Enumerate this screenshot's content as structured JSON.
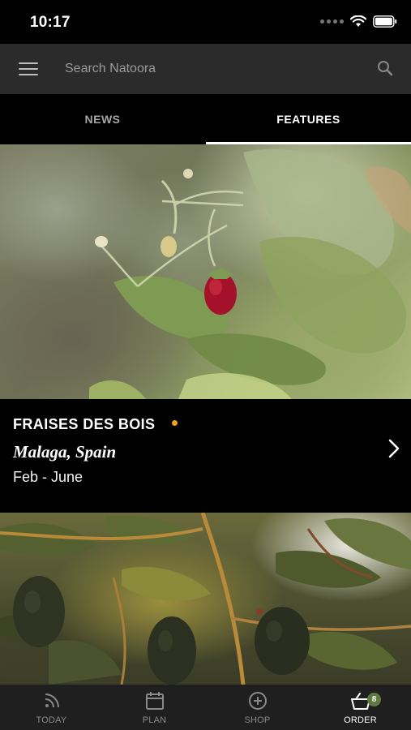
{
  "status_bar": {
    "time": "10:17"
  },
  "search": {
    "placeholder": "Search Natoora"
  },
  "tabs": [
    {
      "label": "NEWS",
      "active": false
    },
    {
      "label": "FEATURES",
      "active": true
    }
  ],
  "feature": {
    "title": "FRAISES DES BOIS",
    "origin": "Malaga, Spain",
    "season": "Feb - June",
    "season_dot_color": "#f0a21c"
  },
  "bottom_nav": {
    "items": [
      {
        "label": "TODAY",
        "icon": "signal-icon",
        "active": false
      },
      {
        "label": "PLAN",
        "icon": "calendar-icon",
        "active": false
      },
      {
        "label": "SHOP",
        "icon": "plus-circle-icon",
        "active": false
      },
      {
        "label": "ORDER",
        "icon": "basket-icon",
        "active": true
      }
    ],
    "order_badge": "8"
  },
  "colors": {
    "header_bg": "#2b2b2b",
    "nav_bg": "#1f1f1f",
    "badge": "#5f7a3e"
  }
}
